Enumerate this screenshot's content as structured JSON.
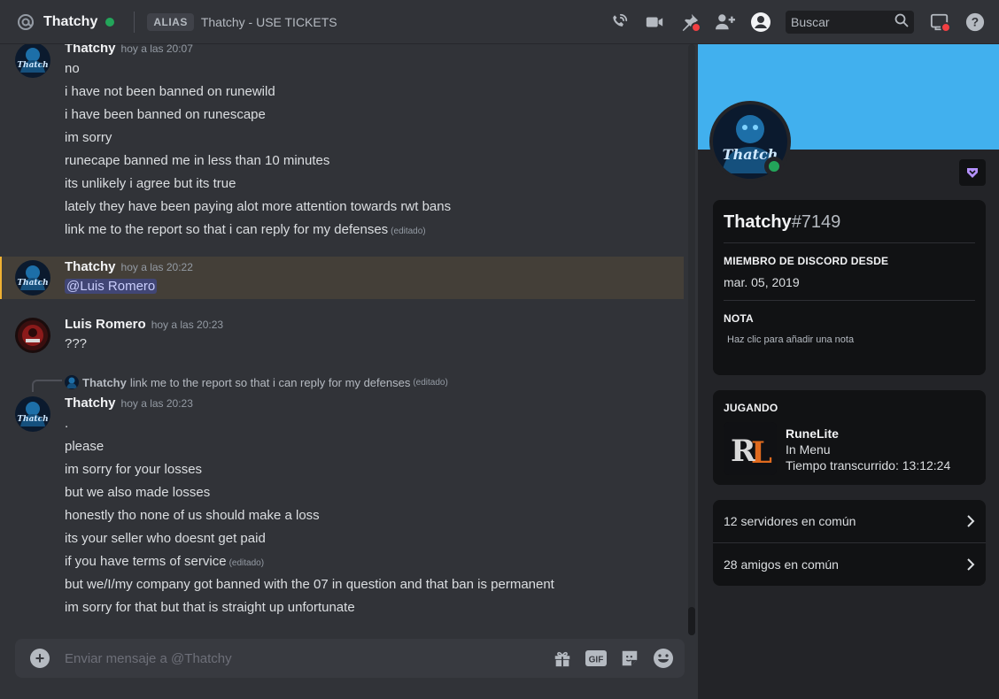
{
  "header": {
    "title": "Thatchy",
    "alias_badge": "ALIAS",
    "alias_text": "Thatchy - USE TICKETS",
    "search_placeholder": "Buscar",
    "icons": [
      "voice-call-icon",
      "video-call-icon",
      "pin-icon",
      "add-friend-icon",
      "user-profile-icon",
      "search-icon",
      "inbox-icon",
      "help-icon"
    ]
  },
  "messages": [
    {
      "author": "Thatchy",
      "time": "hoy a las 20:07",
      "lines": [
        "no",
        "i have not been banned on runewild",
        "i have been banned on runescape",
        "im sorry",
        "runecape banned me in less than 10 minutes",
        "its unlikely i agree but its true",
        "lately they have been paying alot more attention towards rwt bans",
        "link me to the report so that i can reply for my defenses"
      ],
      "edited_label": "(editado)"
    },
    {
      "author": "Thatchy",
      "time": "hoy a las 20:22",
      "mention": "@Luis Romero"
    },
    {
      "author": "Luis Romero",
      "time": "hoy a las 20:23",
      "lines": [
        "???"
      ]
    },
    {
      "reply_author": "Thatchy",
      "reply_text": "link me to the report so that i can reply for my defenses",
      "reply_edited": "(editado)",
      "author": "Thatchy",
      "time": "hoy a las 20:23",
      "lines": [
        ".",
        "please",
        "im sorry for your losses",
        "but we also made losses",
        "honestly tho none of us should make a loss",
        "its your seller who doesnt get paid",
        "if you have terms of service",
        "but we/I/my company got banned with the 07 in question and that ban is permanent",
        "im sorry for that but that is straight up unfortunate"
      ],
      "edited_label": "(editado)"
    }
  ],
  "composer": {
    "placeholder": "Enviar mensaje a @Thatchy",
    "gif_label": "GIF"
  },
  "profile": {
    "username": "Thatchy",
    "discriminator": "#7149",
    "member_since_title": "MIEMBRO DE DISCORD DESDE",
    "member_since_date": "mar. 05, 2019",
    "note_title": "NOTA",
    "note_placeholder": "Haz clic para añadir una nota",
    "activity_title": "JUGANDO",
    "game_name": "RuneLite",
    "game_state": "In Menu",
    "game_elapsed": "Tiempo transcurrido: 13:12:24",
    "mutual_servers": "12 servidores en común",
    "mutual_friends": "28 amigos en común"
  },
  "colors": {
    "banner": "#41b0ee",
    "online": "#23a55a",
    "mention_highlight": "#443f38"
  }
}
